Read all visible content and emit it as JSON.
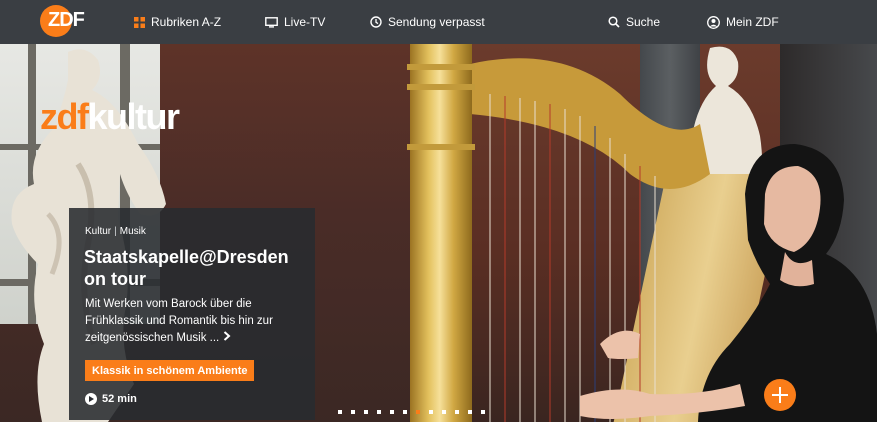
{
  "nav": {
    "logo_text": "ZDF",
    "items": [
      {
        "label": "Rubriken A-Z",
        "icon": "grid-icon"
      },
      {
        "label": "Live-TV",
        "icon": "tv-icon"
      },
      {
        "label": "Sendung verpasst",
        "icon": "clock-icon"
      },
      {
        "label": "Suche",
        "icon": "search-icon"
      },
      {
        "label": "Mein ZDF",
        "icon": "user-icon"
      }
    ]
  },
  "hero": {
    "brand_zdf": "zdf",
    "brand_kultur": "kultur",
    "breadcrumb": [
      "Kultur",
      "Musik"
    ],
    "title": "Staatskapelle@Dresden on tour",
    "description": "Mit Werken vom Barock über die Frühklassik und Romantik bis hin zur zeitgenössischen Musik ...",
    "tag": "Klassik in schönem Ambiente",
    "duration": "52 min",
    "slides_count": 12,
    "active_slide": 6
  },
  "colors": {
    "accent": "#fa7d19",
    "nav_bg": "#3a3e43",
    "card_bg": "#282b30"
  }
}
